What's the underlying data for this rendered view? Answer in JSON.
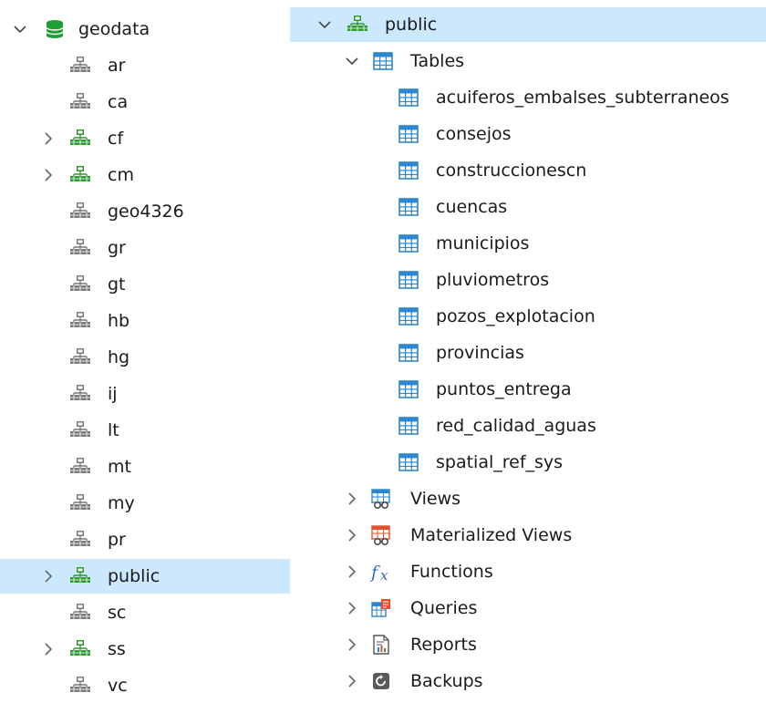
{
  "left_tree": {
    "root": {
      "label": "geodata",
      "expanded": true
    },
    "schemas": [
      {
        "label": "ar",
        "expandable": false,
        "green": false
      },
      {
        "label": "ca",
        "expandable": false,
        "green": false
      },
      {
        "label": "cf",
        "expandable": true,
        "green": true
      },
      {
        "label": "cm",
        "expandable": true,
        "green": true
      },
      {
        "label": "geo4326",
        "expandable": false,
        "green": false
      },
      {
        "label": "gr",
        "expandable": false,
        "green": false
      },
      {
        "label": "gt",
        "expandable": false,
        "green": false
      },
      {
        "label": "hb",
        "expandable": false,
        "green": false
      },
      {
        "label": "hg",
        "expandable": false,
        "green": false
      },
      {
        "label": "ij",
        "expandable": false,
        "green": false
      },
      {
        "label": "lt",
        "expandable": false,
        "green": false
      },
      {
        "label": "mt",
        "expandable": false,
        "green": false
      },
      {
        "label": "my",
        "expandable": false,
        "green": false
      },
      {
        "label": "pr",
        "expandable": false,
        "green": false
      },
      {
        "label": "public",
        "expandable": true,
        "green": true,
        "selected": true
      },
      {
        "label": "sc",
        "expandable": false,
        "green": false
      },
      {
        "label": "ss",
        "expandable": true,
        "green": true
      },
      {
        "label": "vc",
        "expandable": false,
        "green": false
      }
    ]
  },
  "right_tree": {
    "schema": {
      "label": "public",
      "expanded": true
    },
    "tables_group": {
      "label": "Tables",
      "expanded": true
    },
    "tables": [
      "acuiferos_embalses_subterraneos",
      "consejos",
      "construccionescn",
      "cuencas",
      "municipios",
      "pluviometros",
      "pozos_explotacion",
      "provincias",
      "puntos_entrega",
      "red_calidad_aguas",
      "spatial_ref_sys"
    ],
    "other_groups": [
      {
        "label": "Views",
        "icon": "views-icon"
      },
      {
        "label": "Materialized Views",
        "icon": "materialized-views-icon"
      },
      {
        "label": "Functions",
        "icon": "functions-icon"
      },
      {
        "label": "Queries",
        "icon": "queries-icon"
      },
      {
        "label": "Reports",
        "icon": "reports-icon"
      },
      {
        "label": "Backups",
        "icon": "backups-icon"
      }
    ]
  },
  "colors": {
    "selection": "#cce8ff",
    "schema_green": "#2e9a2e",
    "schema_gray": "#7a7a7a",
    "database_green": "#1f9e33",
    "table_blue": "#2b87d1"
  }
}
